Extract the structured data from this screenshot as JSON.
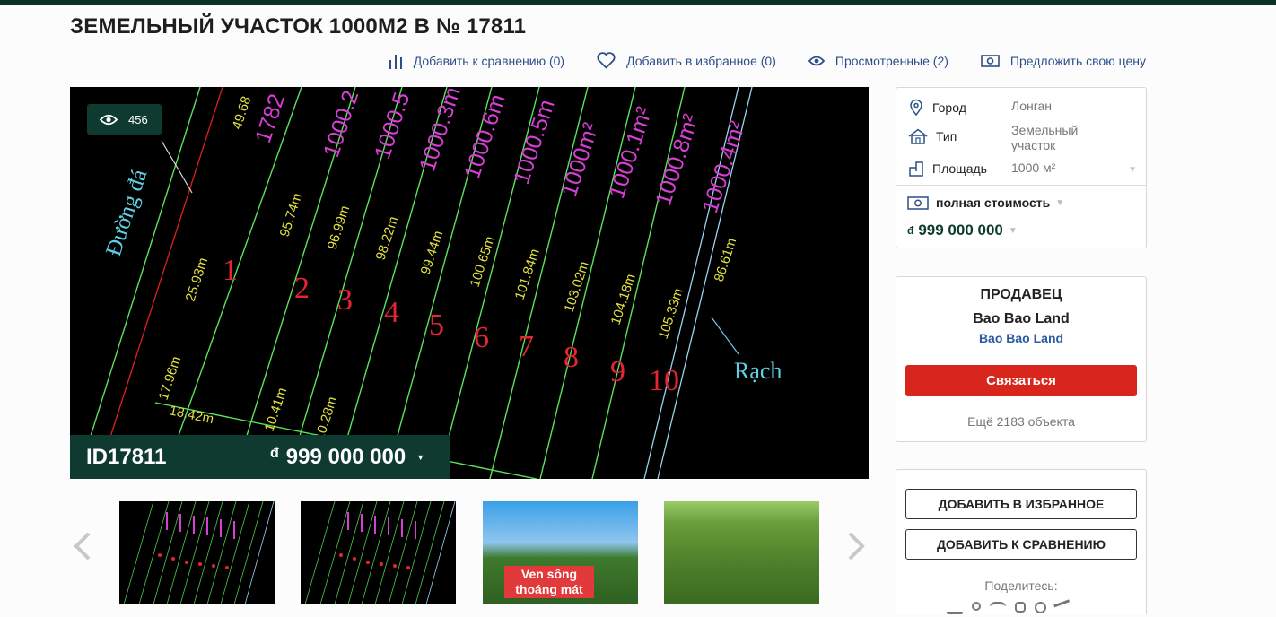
{
  "title": "ЗЕМЕЛЬНЫЙ УЧАСТОК 1000М2 В № 17811",
  "actions": {
    "compare": "Добавить к сравнению (0)",
    "favorite": "Добавить в избранное (0)",
    "viewed": "Просмотренные (2)",
    "offer": "Предложить свою цену"
  },
  "gallery": {
    "views": "456",
    "id": "ID17811",
    "currency": "đ",
    "price": "999 000 000",
    "plot_labels": [
      "Đường đá",
      "Rạch"
    ],
    "lot_numbers": [
      "1",
      "2",
      "3",
      "4",
      "5",
      "6",
      "7",
      "8",
      "9",
      "10"
    ],
    "areas": [
      "1782",
      "1000.2",
      "1000.5",
      "1000.3m",
      "1000.6m",
      "1000.5m",
      "1000m²",
      "1000.1m²",
      "1000.8m²",
      "1000.4m²"
    ],
    "lengths": [
      "49.68",
      "95.74m",
      "96.99m",
      "98.22m",
      "99.44m",
      "100.65m",
      "101.84m",
      "103.02m",
      "104.18m",
      "105.33m",
      "86.61m"
    ],
    "other_dims": [
      "25.93m",
      "17.96m",
      "18.42m",
      "10.41m",
      "10.28m"
    ],
    "thumb_caption": "Ven sông thoáng mát"
  },
  "info": {
    "city_label": "Город",
    "city_value": "Лонган",
    "type_label": "Тип",
    "type_value": "Земельный участок",
    "area_label": "Площадь",
    "area_value": "1000 м²",
    "price_type": "полная стоимость",
    "currency": "đ",
    "price": "999 000 000"
  },
  "seller": {
    "heading": "ПРОДАВЕЦ",
    "name": "Bao Bao Land",
    "link": "Bao Bao Land",
    "contact_button": "Связаться",
    "more_objects": "Ещё 2183 объекта"
  },
  "buttons": {
    "add_favorite": "ДОБАВИТЬ В ИЗБРАННОЕ",
    "add_compare": "ДОБАВИТЬ К СРАВНЕНИЮ",
    "share_label": "Поделитесь:"
  },
  "colors": {
    "brand_dark": "#0e3a2f",
    "link_blue": "#2c4f8a",
    "contact_red": "#d8261d"
  }
}
